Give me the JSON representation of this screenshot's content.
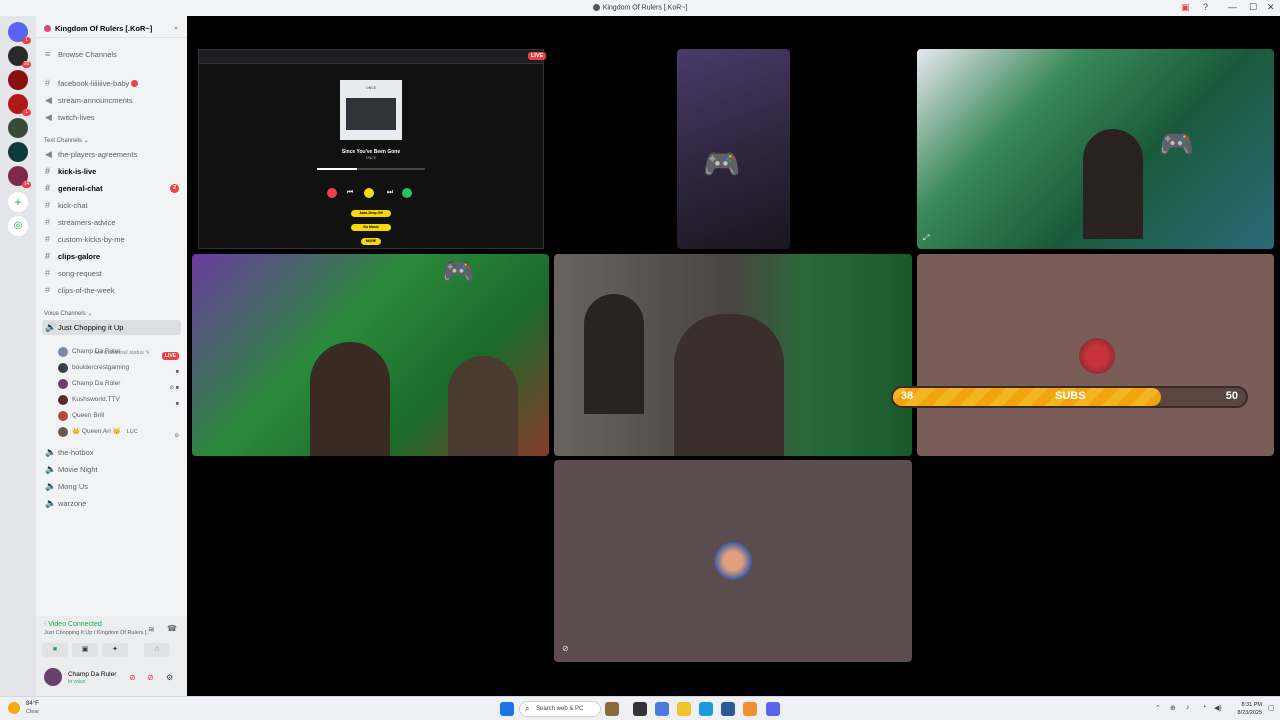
{
  "window": {
    "title": "Kingdom Of Rulers [.KoR~]",
    "controls": [
      "—",
      "☐",
      "✕"
    ]
  },
  "servers": [
    {
      "badge": "1"
    },
    {
      "badge": "20"
    },
    {
      "badge": ""
    },
    {
      "badge": "1"
    },
    {
      "badge": ""
    },
    {
      "badge": ""
    },
    {
      "badge": "14"
    }
  ],
  "sidebar": {
    "server_name": "Kingdom Of Rulers [.KoR~]",
    "browse": "Browse Channels",
    "channels_top": [
      {
        "name": "facebook-liiiiiive-baby",
        "icon": "#"
      },
      {
        "name": "stream-announcments",
        "icon": "📢"
      },
      {
        "name": "twitch-lives",
        "icon": "📢"
      }
    ],
    "text_category": "Text Channels",
    "text_channels": [
      {
        "name": "the-players-agreements",
        "icon": "📢",
        "bold": false,
        "badge": ""
      },
      {
        "name": "kick-is-live",
        "icon": "#",
        "bold": true,
        "badge": ""
      },
      {
        "name": "general-chat",
        "icon": "#",
        "bold": true,
        "badge": "2"
      },
      {
        "name": "kick-chat",
        "icon": "#",
        "bold": false,
        "badge": ""
      },
      {
        "name": "streamers-advice",
        "icon": "#",
        "bold": false,
        "badge": ""
      },
      {
        "name": "custom-kicks-by-me",
        "icon": "#",
        "bold": false,
        "badge": ""
      },
      {
        "name": "clips-galore",
        "icon": "#",
        "bold": true,
        "badge": ""
      },
      {
        "name": "song-request",
        "icon": "#",
        "bold": false,
        "badge": ""
      },
      {
        "name": "clips-of-the-week",
        "icon": "#",
        "bold": false,
        "badge": ""
      }
    ],
    "voice_category": "Voice Channels",
    "active_voice": "Just Chopping it Up",
    "voice_status": "Set a channel status",
    "voice_users": [
      {
        "name": "Champ Da Ruler",
        "color": "#7a8aa0",
        "tag": "LIVE"
      },
      {
        "name": "bouldercrestgaming",
        "color": "#3a3f48",
        "tag": ""
      },
      {
        "name": "Champ Da Ruler",
        "color": "#6b3f6e",
        "tag": ""
      },
      {
        "name": "Kushsworld.TTV",
        "color": "#5a2a2a",
        "tag": ""
      },
      {
        "name": "Queen Brill",
        "color": "#b04a3a",
        "tag": ""
      },
      {
        "name": "👑 Queen Ari 👑",
        "color": "#6a5a4a",
        "tag": "LUC"
      }
    ],
    "other_voice": [
      {
        "name": "the-hotbox"
      },
      {
        "name": "Movie Night"
      },
      {
        "name": "Mong Us"
      },
      {
        "name": "warzone"
      }
    ]
  },
  "panel": {
    "connected": "Video Connected",
    "location": "Just Chopping It Up / Kingdom Of Rulers [...",
    "username": "Champ Da Ruler",
    "status": "In voice"
  },
  "stream": {
    "live_label": "LIVE",
    "song": "Since You've Been Gone",
    "artist": "ONCE",
    "album_text": "ONCE",
    "buttons": [
      "Auto-Drop Off",
      "Go Music",
      "MORE"
    ]
  },
  "subs_bar": {
    "current": "38",
    "label": "SUBS",
    "goal": "50",
    "progress": 0.76,
    "colors": {
      "fill": "#f4b522",
      "track": "#5a4540"
    }
  },
  "taskbar": {
    "weather_temp": "84°F",
    "weather_cond": "Clear",
    "search_placeholder": "Search web & PC",
    "time": "8:31 PM",
    "date": "8/23/2025"
  }
}
